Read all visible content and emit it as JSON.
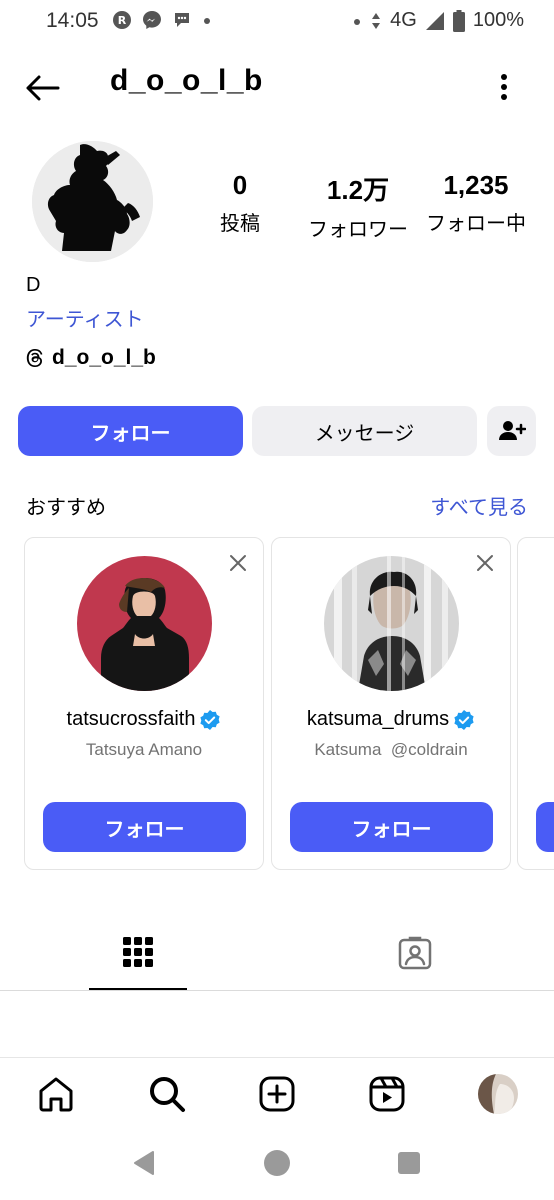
{
  "status_bar": {
    "time": "14:05",
    "network": "4G",
    "battery": "100%",
    "icons_left": [
      "rakuten-icon",
      "messenger-icon",
      "chat-bubble-icon",
      "dot-icon"
    ],
    "icons_right": [
      "dot-icon",
      "data-arrows-icon",
      "signal-icon",
      "battery-icon"
    ]
  },
  "header": {
    "username": "d_o_o_l_b"
  },
  "profile": {
    "stats": [
      {
        "value": "0",
        "label": "投稿"
      },
      {
        "value": "1.2万",
        "label": "フォロワー"
      },
      {
        "value": "1,235",
        "label": "フォロー中"
      }
    ],
    "name": "D",
    "category": "アーティスト",
    "threads_handle": "d_o_o_l_b"
  },
  "actions": {
    "follow": "フォロー",
    "message": "メッセージ"
  },
  "suggestions": {
    "title": "おすすめ",
    "see_all": "すべて見る",
    "cards": [
      {
        "handle": "tatsucrossfaith",
        "subtitle": "Tatsuya Amano",
        "verified": true,
        "button": "フォロー"
      },
      {
        "handle": "katsuma_drums",
        "subtitle": "Katsuma  @coldrain",
        "verified": true,
        "button": "フォロー"
      }
    ]
  },
  "tabs": [
    "grid-icon",
    "tagged-icon"
  ],
  "bottom_nav": [
    "home-icon",
    "search-icon",
    "create-icon",
    "reels-icon",
    "profile-avatar"
  ],
  "colors": {
    "accent": "#4a5cf6",
    "link": "#3e56d4",
    "verified": "#1d9bf0",
    "secondary_button": "#efeff2"
  }
}
